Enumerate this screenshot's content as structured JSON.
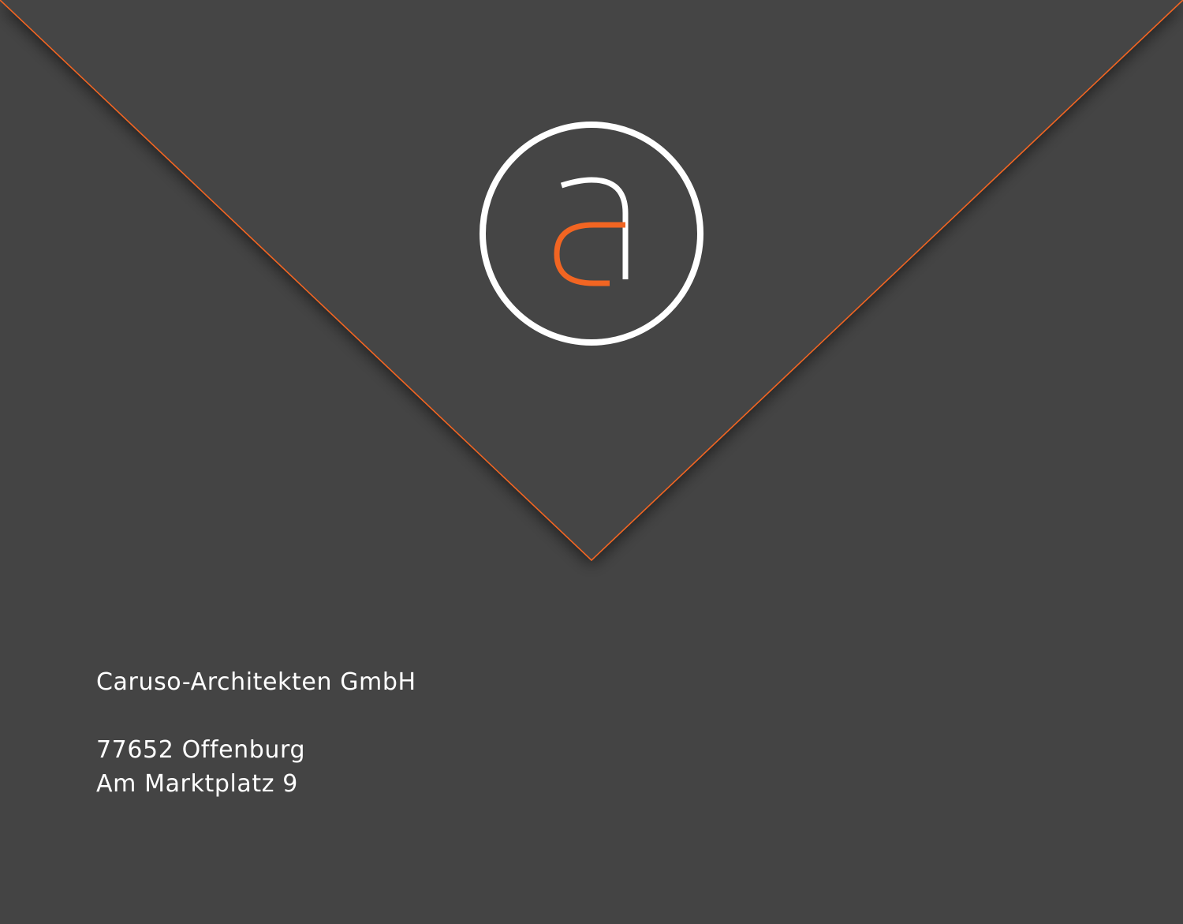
{
  "colors": {
    "background": "#444444",
    "accent": "#f26522",
    "logo_stroke": "#ffffff"
  },
  "logo": {
    "icon": "caruso-a-monogram-icon"
  },
  "address": {
    "company": "Caruso-Architekten GmbH",
    "city_line": "77652 Offenburg",
    "street_line": "Am Marktplatz 9"
  }
}
